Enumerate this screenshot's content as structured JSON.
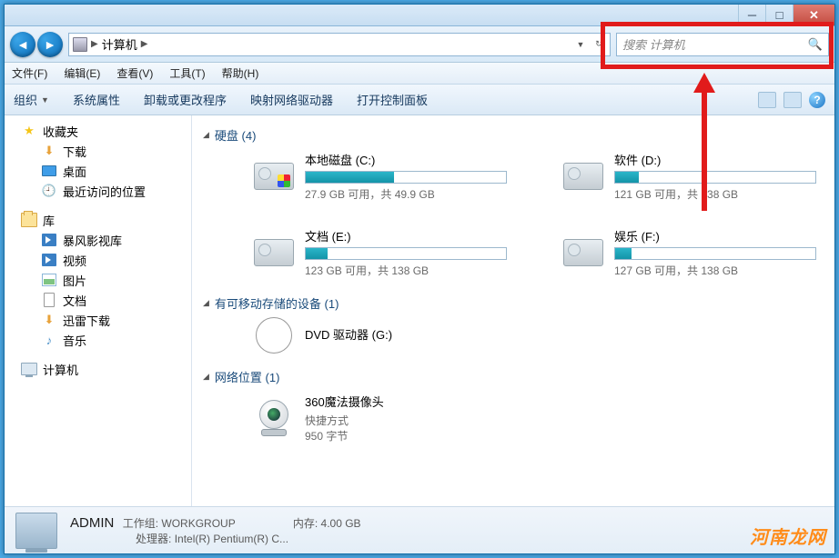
{
  "address": {
    "location": "计算机"
  },
  "search": {
    "placeholder": "搜索 计算机"
  },
  "menubar": [
    "文件(F)",
    "编辑(E)",
    "查看(V)",
    "工具(T)",
    "帮助(H)"
  ],
  "toolbar": {
    "organize": "组织",
    "items": [
      "系统属性",
      "卸载或更改程序",
      "映射网络驱动器",
      "打开控制面板"
    ]
  },
  "sidebar": {
    "favorites": {
      "label": "收藏夹",
      "items": [
        "下载",
        "桌面",
        "最近访问的位置"
      ]
    },
    "libraries": {
      "label": "库",
      "items": [
        "暴风影视库",
        "视频",
        "图片",
        "文档",
        "迅雷下载",
        "音乐"
      ]
    },
    "computer": {
      "label": "计算机"
    }
  },
  "sections": {
    "hdd": {
      "title": "硬盘 (4)"
    },
    "removable": {
      "title": "有可移动存储的设备 (1)"
    },
    "network": {
      "title": "网络位置 (1)"
    }
  },
  "drives": [
    {
      "name": "本地磁盘 (C:)",
      "stat": "27.9 GB 可用，共 49.9 GB",
      "pct": 44,
      "win": true
    },
    {
      "name": "软件 (D:)",
      "stat": "121 GB 可用，共 138 GB",
      "pct": 12
    },
    {
      "name": "文档 (E:)",
      "stat": "123 GB 可用，共 138 GB",
      "pct": 11
    },
    {
      "name": "娱乐 (F:)",
      "stat": "127 GB 可用，共 138 GB",
      "pct": 8
    }
  ],
  "dvd": {
    "name": "DVD 驱动器 (G:)"
  },
  "netloc": {
    "name": "360魔法摄像头",
    "sub1": "快捷方式",
    "sub2": "950 字节"
  },
  "status": {
    "name": "ADMIN",
    "workgroup_label": "工作组:",
    "workgroup": "WORKGROUP",
    "mem_label": "内存:",
    "mem": "4.00 GB",
    "cpu_label": "处理器:",
    "cpu": "Intel(R) Pentium(R) C..."
  },
  "watermark": "河南龙网"
}
